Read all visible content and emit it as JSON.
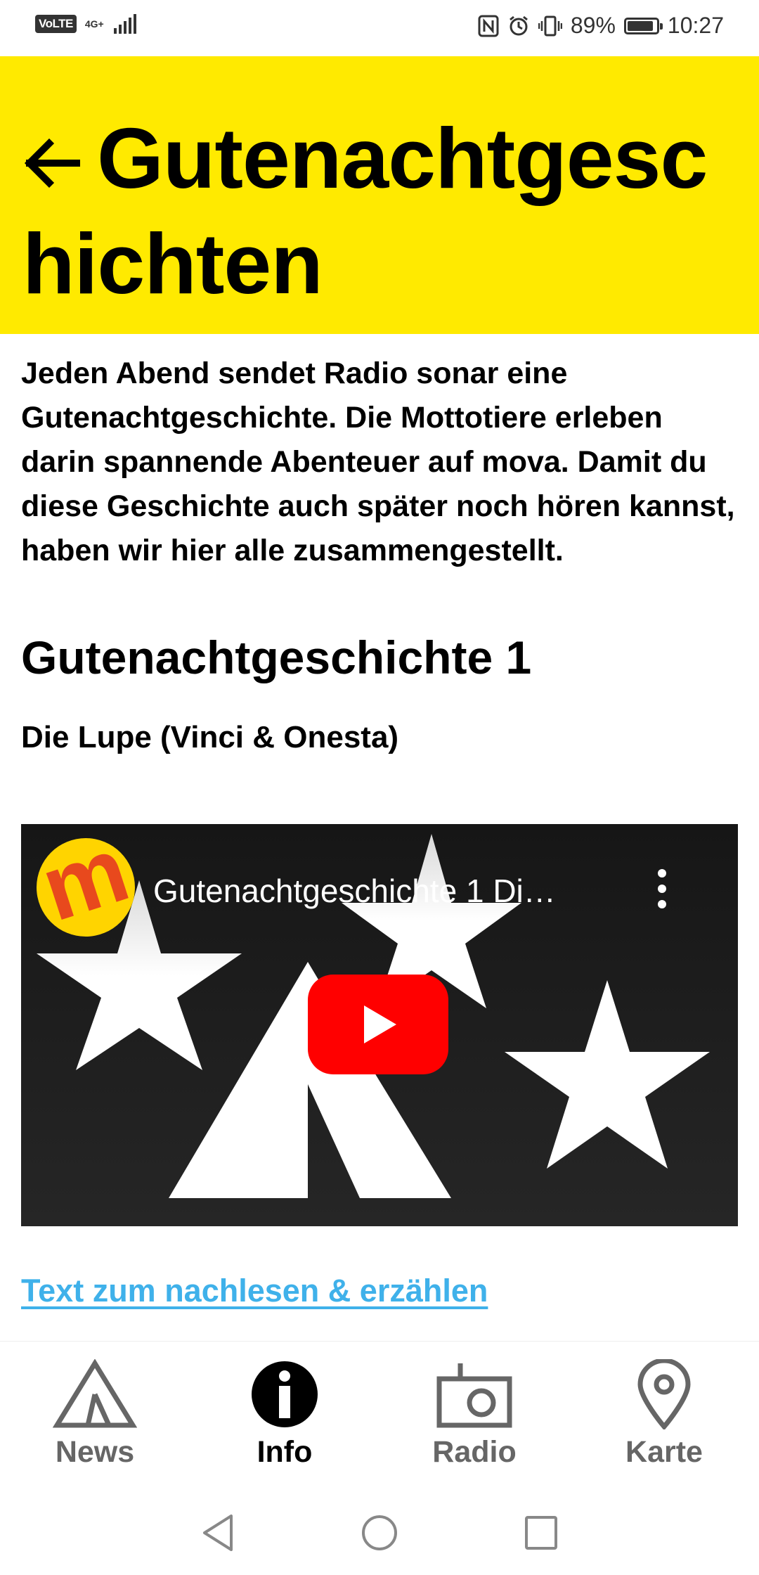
{
  "status_bar": {
    "volte": "VoLTE",
    "network": "4G+",
    "battery_percent": "89%",
    "battery_level": 0.89,
    "time": "10:27"
  },
  "header": {
    "title": "Gutenachtgeschichten",
    "back_icon": "arrow-left-icon",
    "background_color": "#ffea00"
  },
  "content": {
    "intro": "Jeden Abend sendet Radio sonar eine Gutenachtgeschichte. Die Mottotiere erleben darin spannende Abenteuer auf mova. Damit du diese Geschichte auch später noch hören kannst, haben wir hier alle zusammengestellt.",
    "section_title": "Gutenachtgeschichte 1",
    "story_subtitle": "Die Lupe (Vinci & Onesta)",
    "video": {
      "title": "Gutenachtgeschichte 1 Di…",
      "channel_logo_letter": "m",
      "play_icon": "youtube-play-icon",
      "more_icon": "more-vertical-icon"
    },
    "link_text": "Text zum nachlesen & erzählen",
    "link_color": "#3fb1ea"
  },
  "bottom_nav": {
    "items": [
      {
        "label": "News",
        "icon": "tent-icon",
        "active": false
      },
      {
        "label": "Info",
        "icon": "info-icon",
        "active": true
      },
      {
        "label": "Radio",
        "icon": "radio-icon",
        "active": false
      },
      {
        "label": "Karte",
        "icon": "map-pin-icon",
        "active": false
      }
    ]
  },
  "system_nav": {
    "back": "back-triangle-icon",
    "home": "home-circle-icon",
    "recents": "recents-square-icon"
  }
}
